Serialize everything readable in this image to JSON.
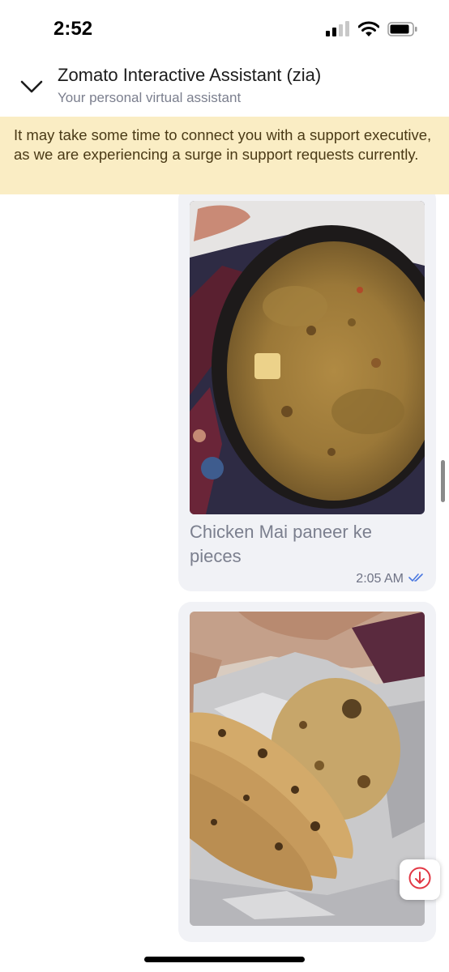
{
  "status_bar": {
    "time": "2:52"
  },
  "header": {
    "title": "Zomato Interactive Assistant (zia)",
    "subtitle": "Your personal virtual assistant",
    "back_icon": "chevron-down-icon"
  },
  "banner": {
    "text": "It may take some time to connect you with a support executive, as we are experiencing a surge in support requests currently."
  },
  "messages": [
    {
      "type": "image",
      "caption": "Chicken Mai paneer ke pieces",
      "time": "2:05 AM",
      "status_icon": "double-check-icon"
    },
    {
      "type": "image"
    }
  ],
  "colors": {
    "banner_bg": "#faedc4",
    "bubble_bg": "#f1f2f6",
    "accent": "#e23744",
    "read_tick": "#4a78e0"
  },
  "scroll_down_icon": "arrow-down-circle-icon"
}
